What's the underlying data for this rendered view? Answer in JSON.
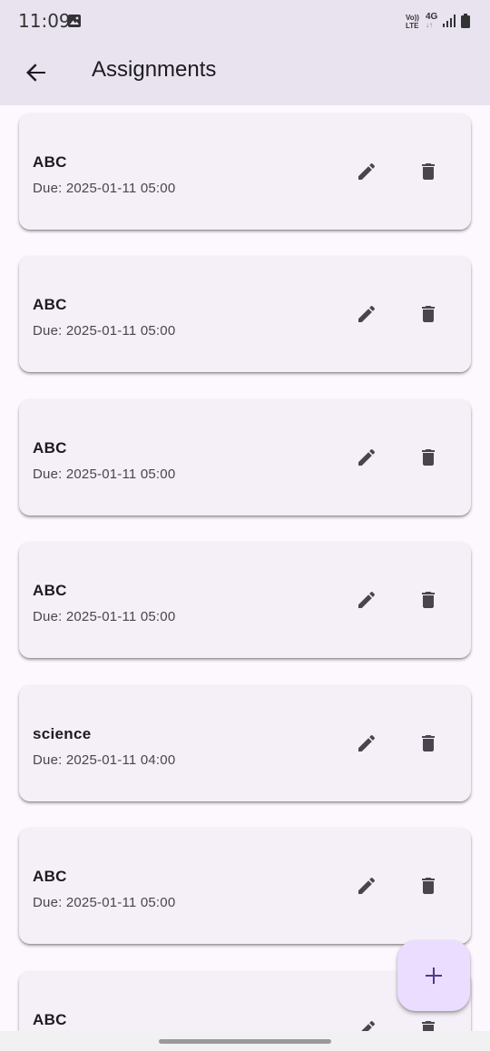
{
  "status_bar": {
    "time": "11:09",
    "volte_top": "Vo))",
    "volte_bottom": "LTE",
    "network": "4G",
    "icons": [
      "gallery-icon",
      "signal-icon",
      "battery-icon"
    ]
  },
  "app_bar": {
    "title": "Assignments",
    "back_icon": "arrow-back-icon"
  },
  "assignments": [
    {
      "title": "ABC",
      "due": "Due: 2025-01-11 05:00"
    },
    {
      "title": "ABC",
      "due": "Due: 2025-01-11 05:00"
    },
    {
      "title": "ABC",
      "due": "Due: 2025-01-11 05:00"
    },
    {
      "title": "ABC",
      "due": "Due: 2025-01-11 05:00"
    },
    {
      "title": "science",
      "due": "Due: 2025-01-11 04:00"
    },
    {
      "title": "ABC",
      "due": "Due: 2025-01-11 05:00"
    },
    {
      "title": "ABC",
      "due": ""
    }
  ],
  "card_actions": {
    "edit_icon": "edit-icon",
    "delete_icon": "delete-icon"
  },
  "fab": {
    "icon": "add-icon"
  },
  "colors": {
    "app_bar": "#e9e3f0",
    "background": "#fdf7fe",
    "card": "#f5eff7",
    "fab": "#eaddff",
    "fab_icon": "#4f378b"
  }
}
